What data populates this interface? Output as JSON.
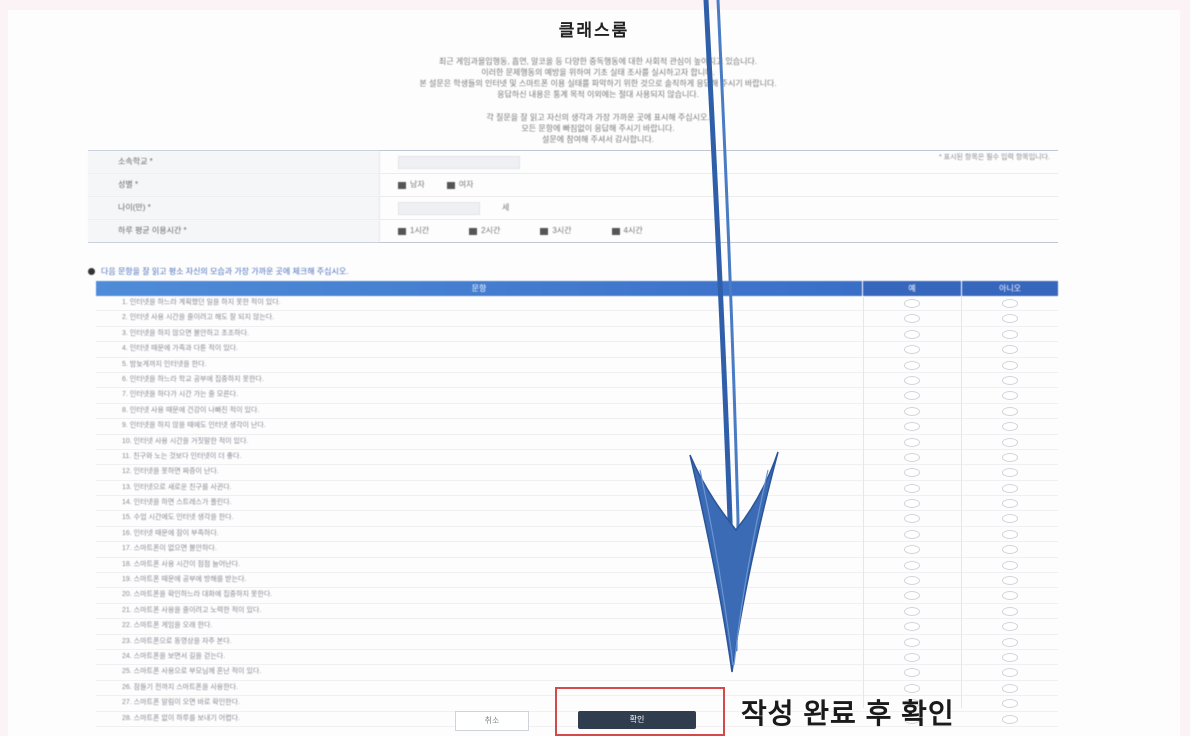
{
  "page": {
    "title": "클래스룸",
    "intro_lines": [
      "최근 게임과몰입행동, 흡연, 알코올 등 다양한 중독행동에 대한 사회적 관심이 높아지고 있습니다.",
      "이러한 문제행동의 예방을 위하여 기초 실태 조사를 실시하고자 합니다.",
      "본 설문은 학생들의 인터넷 및 스마트폰 이용 실태를 파악하기 위한 것으로 솔직하게 응답해 주시기 바랍니다.",
      "응답하신 내용은 통계 목적 이외에는 절대 사용되지 않습니다."
    ],
    "intro2_lines": [
      "각 질문을 잘 읽고 자신의 생각과 가장 가까운 곳에 표시해 주십시오.",
      "모든 문항에 빠짐없이 응답해 주시기 바랍니다.",
      "설문에 참여해 주셔서 감사합니다."
    ],
    "required_note": "* 표시된 항목은 필수 입력 항목입니다."
  },
  "info_form": {
    "rows": [
      {
        "label": "소속학교 *",
        "type": "input"
      },
      {
        "label": "성별 *",
        "type": "radio",
        "options": [
          "남자",
          "여자"
        ]
      },
      {
        "label": "나이(만) *",
        "type": "input-short",
        "suffix": "세"
      },
      {
        "label": "하루 평균 이용시간 *",
        "type": "radio",
        "options": [
          "1시간",
          "2시간",
          "3시간",
          "4시간"
        ]
      }
    ]
  },
  "survey": {
    "guide": "다음 문항을 잘 읽고 평소 자신의 모습과 가장 가까운 곳에 체크해 주십시오.",
    "headers": {
      "question": "문항",
      "yes": "예",
      "no": "아니오"
    },
    "questions": [
      "1. 인터넷을 하느라 계획했던 일을 하지 못한 적이 있다.",
      "2. 인터넷 사용 시간을 줄이려고 해도 잘 되지 않는다.",
      "3. 인터넷을 하지 않으면 불안하고 초조하다.",
      "4. 인터넷 때문에 가족과 다툰 적이 있다.",
      "5. 밤늦게까지 인터넷을 한다.",
      "6. 인터넷을 하느라 학교 공부에 집중하지 못한다.",
      "7. 인터넷을 하다가 시간 가는 줄 모른다.",
      "8. 인터넷 사용 때문에 건강이 나빠진 적이 있다.",
      "9. 인터넷을 하지 않을 때에도 인터넷 생각이 난다.",
      "10. 인터넷 사용 시간을 거짓말한 적이 있다.",
      "11. 친구와 노는 것보다 인터넷이 더 좋다.",
      "12. 인터넷을 못하면 짜증이 난다.",
      "13. 인터넷으로 새로운 친구를 사귄다.",
      "14. 인터넷을 하면 스트레스가 풀린다.",
      "15. 수업 시간에도 인터넷 생각을 한다.",
      "16. 인터넷 때문에 잠이 부족하다.",
      "17. 스마트폰이 없으면 불안하다.",
      "18. 스마트폰 사용 시간이 점점 늘어난다.",
      "19. 스마트폰 때문에 공부에 방해를 받는다.",
      "20. 스마트폰을 확인하느라 대화에 집중하지 못한다.",
      "21. 스마트폰 사용을 줄이려고 노력한 적이 있다.",
      "22. 스마트폰 게임을 오래 한다.",
      "23. 스마트폰으로 동영상을 자주 본다.",
      "24. 스마트폰을 보면서 길을 걷는다.",
      "25. 스마트폰 사용으로 부모님께 혼난 적이 있다.",
      "26. 잠들기 전까지 스마트폰을 사용한다.",
      "27. 스마트폰 알림이 오면 바로 확인한다.",
      "28. 스마트폰 없이 하루를 보내기 어렵다."
    ]
  },
  "buttons": {
    "cancel": "취소",
    "confirm": "확인"
  },
  "annotation": {
    "callout": "작성 완료 후 확인"
  },
  "colors": {
    "header_blue": "#3a6fc8",
    "confirm_dark": "#2f3d4f",
    "arrow_blue": "#3b6bb5",
    "highlight_red": "#d24a4a"
  }
}
